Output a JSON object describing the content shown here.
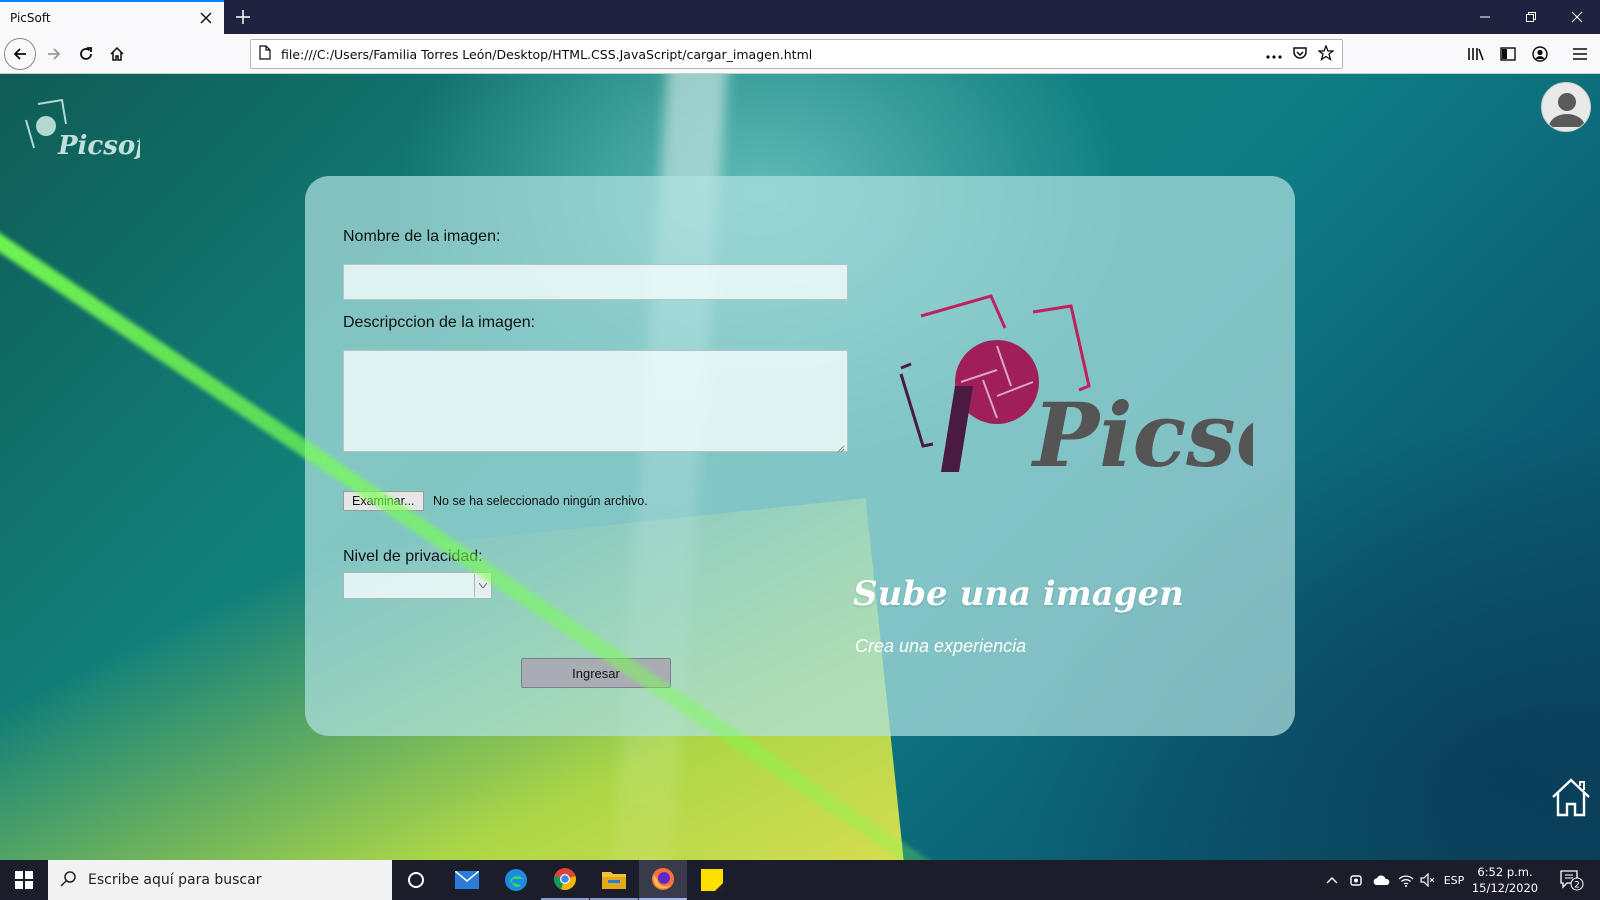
{
  "browser": {
    "tab_title": "PicSoft",
    "url": "file:///C:/Users/Familia Torres León/Desktop/HTML.CSS.JavaScript/cargar_imagen.html"
  },
  "page": {
    "corner_logo_text": "Picsoft",
    "form": {
      "name_label": "Nombre de la imagen:",
      "name_value": "",
      "description_label": "Descripccion de la imagen:",
      "description_value": "",
      "file_button_label": "Examinar...",
      "file_status": "No se ha seleccionado ningún archivo.",
      "privacy_label": "Nivel de privacidad:",
      "privacy_selected": "",
      "submit_label": "Ingresar"
    },
    "brand_logo_text": "Picsoft",
    "tagline": "Sube una imagen",
    "subtagline": "Crea una experiencia",
    "colors": {
      "brand_magenta": "#a01f5a",
      "brand_purple": "#5a1f4a",
      "brand_gray": "#555555"
    }
  },
  "taskbar": {
    "search_placeholder": "Escribe aquí para buscar",
    "language": "ESP",
    "time": "6:52 p.m.",
    "date": "15/12/2020",
    "notification_count": "2"
  }
}
